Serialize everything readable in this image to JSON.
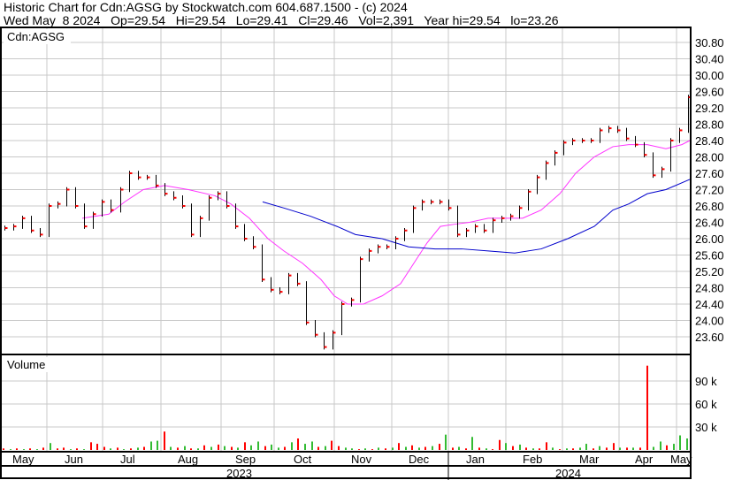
{
  "header": {
    "title": "Historic Chart for Cdn:AGSG by Stockwatch.com 604.687.1500 - (c) 2024",
    "quote": "Wed May  8 2024   Op=29.54   Hi=29.54   Lo=29.41   Cl=29.46   Vol=2,391   Year hi=29.54   lo=23.26"
  },
  "chart_data": {
    "type": "line",
    "symbol_label": "Cdn:AGSG",
    "volume_label": "Volume",
    "price_ticks": [
      "30.80",
      "30.40",
      "30.00",
      "29.60",
      "29.20",
      "28.80",
      "28.40",
      "28.00",
      "27.60",
      "27.20",
      "26.80",
      "26.40",
      "26.00",
      "25.60",
      "25.20",
      "24.80",
      "24.40",
      "24.00",
      "23.60"
    ],
    "price_range": [
      23.2,
      31.2
    ],
    "volume_ticks": [
      "90 k",
      "60 k",
      "30 k"
    ],
    "volume_unit": "thousands",
    "months": [
      "May",
      "Jun",
      "Jul",
      "Aug",
      "Sep",
      "Oct",
      "Nov",
      "Dec",
      "Jan",
      "Feb",
      "Mar",
      "Apr",
      "May"
    ],
    "years": [
      "2023",
      "2024"
    ],
    "colors": {
      "bar": "#000000",
      "tick": "#ff0000",
      "ma_short": "#ff33ff",
      "ma_long": "#0000cc",
      "vol_up": "#33bb33",
      "vol_down": "#ff0000",
      "grid": "#c8c8c8"
    },
    "closes": [
      26.26,
      26.3,
      26.5,
      26.2,
      26.1,
      26.8,
      26.85,
      27.2,
      26.8,
      26.3,
      26.6,
      26.9,
      26.7,
      27.2,
      27.6,
      27.5,
      27.5,
      27.3,
      27.1,
      27.0,
      26.8,
      26.1,
      26.5,
      27.0,
      27.1,
      26.8,
      26.3,
      26.0,
      25.8,
      25.0,
      24.75,
      24.7,
      25.1,
      24.9,
      23.95,
      23.65,
      23.35,
      23.7,
      24.4,
      24.5,
      25.5,
      25.7,
      25.8,
      25.8,
      26.0,
      26.2,
      26.75,
      26.9,
      26.9,
      26.9,
      26.75,
      26.1,
      26.2,
      26.3,
      26.2,
      26.45,
      26.5,
      26.55,
      26.75,
      27.15,
      27.5,
      27.85,
      28.1,
      28.35,
      28.4,
      28.4,
      28.4,
      28.65,
      28.7,
      28.65,
      28.45,
      28.3,
      28.05,
      27.55,
      27.7,
      28.4,
      28.65,
      29.46
    ],
    "ma_short": [
      [
        30,
        26.5
      ],
      [
        40,
        26.6
      ],
      [
        46,
        26.9
      ],
      [
        53,
        27.2
      ],
      [
        61,
        27.3
      ],
      [
        70,
        27.2
      ],
      [
        80,
        27.05
      ],
      [
        86,
        26.85
      ],
      [
        93,
        26.5
      ],
      [
        100,
        26.0
      ],
      [
        106,
        25.7
      ],
      [
        113,
        25.4
      ],
      [
        120,
        25.0
      ],
      [
        125,
        24.6
      ],
      [
        130,
        24.4
      ],
      [
        136,
        24.4
      ],
      [
        143,
        24.6
      ],
      [
        150,
        24.9
      ],
      [
        155,
        25.4
      ],
      [
        160,
        25.9
      ],
      [
        165,
        26.3
      ],
      [
        170,
        26.35
      ],
      [
        176,
        26.4
      ],
      [
        183,
        26.5
      ],
      [
        190,
        26.5
      ],
      [
        196,
        26.5
      ],
      [
        203,
        26.7
      ],
      [
        210,
        27.1
      ],
      [
        216,
        27.6
      ],
      [
        223,
        28.0
      ],
      [
        230,
        28.25
      ],
      [
        236,
        28.3
      ],
      [
        243,
        28.3
      ],
      [
        250,
        28.2
      ],
      [
        256,
        28.3
      ],
      [
        259,
        28.4
      ]
    ],
    "ma_long": [
      [
        98,
        26.9
      ],
      [
        106,
        26.75
      ],
      [
        116,
        26.55
      ],
      [
        126,
        26.3
      ],
      [
        133,
        26.1
      ],
      [
        143,
        26.0
      ],
      [
        153,
        25.8
      ],
      [
        163,
        25.75
      ],
      [
        173,
        25.75
      ],
      [
        183,
        25.7
      ],
      [
        193,
        25.65
      ],
      [
        203,
        25.75
      ],
      [
        213,
        26.0
      ],
      [
        223,
        26.3
      ],
      [
        230,
        26.7
      ],
      [
        236,
        26.85
      ],
      [
        243,
        27.1
      ],
      [
        250,
        27.2
      ],
      [
        259,
        27.45
      ]
    ],
    "volume": [
      2,
      1,
      2,
      1,
      2,
      1,
      3,
      9,
      2,
      3,
      1,
      2,
      1,
      10,
      8,
      4,
      2,
      3,
      1,
      2,
      3,
      4,
      11,
      12,
      24,
      4,
      3,
      5,
      2,
      2,
      6,
      4,
      7,
      5,
      4,
      3,
      10,
      6,
      11,
      5,
      7,
      3,
      4,
      10,
      15,
      8,
      11,
      4,
      5,
      12,
      5,
      3,
      2,
      1,
      2,
      1,
      3,
      2,
      3,
      9,
      4,
      6,
      3,
      4,
      5,
      8,
      20,
      3,
      4,
      2,
      17,
      3,
      2,
      1,
      13,
      9,
      5,
      7,
      3,
      2,
      2,
      10,
      3,
      1,
      2,
      2,
      3,
      8,
      2,
      5,
      3,
      9,
      3,
      3,
      3,
      3,
      110,
      4,
      11,
      6,
      8,
      19,
      15
    ],
    "volume_up": [
      0,
      1,
      0,
      1,
      0,
      1,
      0,
      1,
      0,
      0,
      1,
      0,
      1,
      0,
      0,
      0,
      1,
      0,
      1,
      0,
      1,
      0,
      1,
      1,
      0,
      1,
      0,
      1,
      0,
      1,
      0,
      1,
      0,
      1,
      0,
      1,
      0,
      1,
      1,
      0,
      1,
      1,
      0,
      1,
      0,
      1,
      1,
      0,
      1,
      0,
      0,
      1,
      1,
      0,
      1,
      0,
      1,
      0,
      1,
      0,
      1,
      0,
      1,
      0,
      1,
      0,
      1,
      0,
      1,
      0,
      1,
      0,
      1,
      0,
      0,
      1,
      0,
      1,
      0,
      1,
      0,
      0,
      1,
      0,
      1,
      0,
      1,
      1,
      0,
      1,
      0,
      0,
      1,
      0,
      1,
      0,
      0,
      1,
      1,
      0,
      1,
      1,
      1
    ]
  }
}
